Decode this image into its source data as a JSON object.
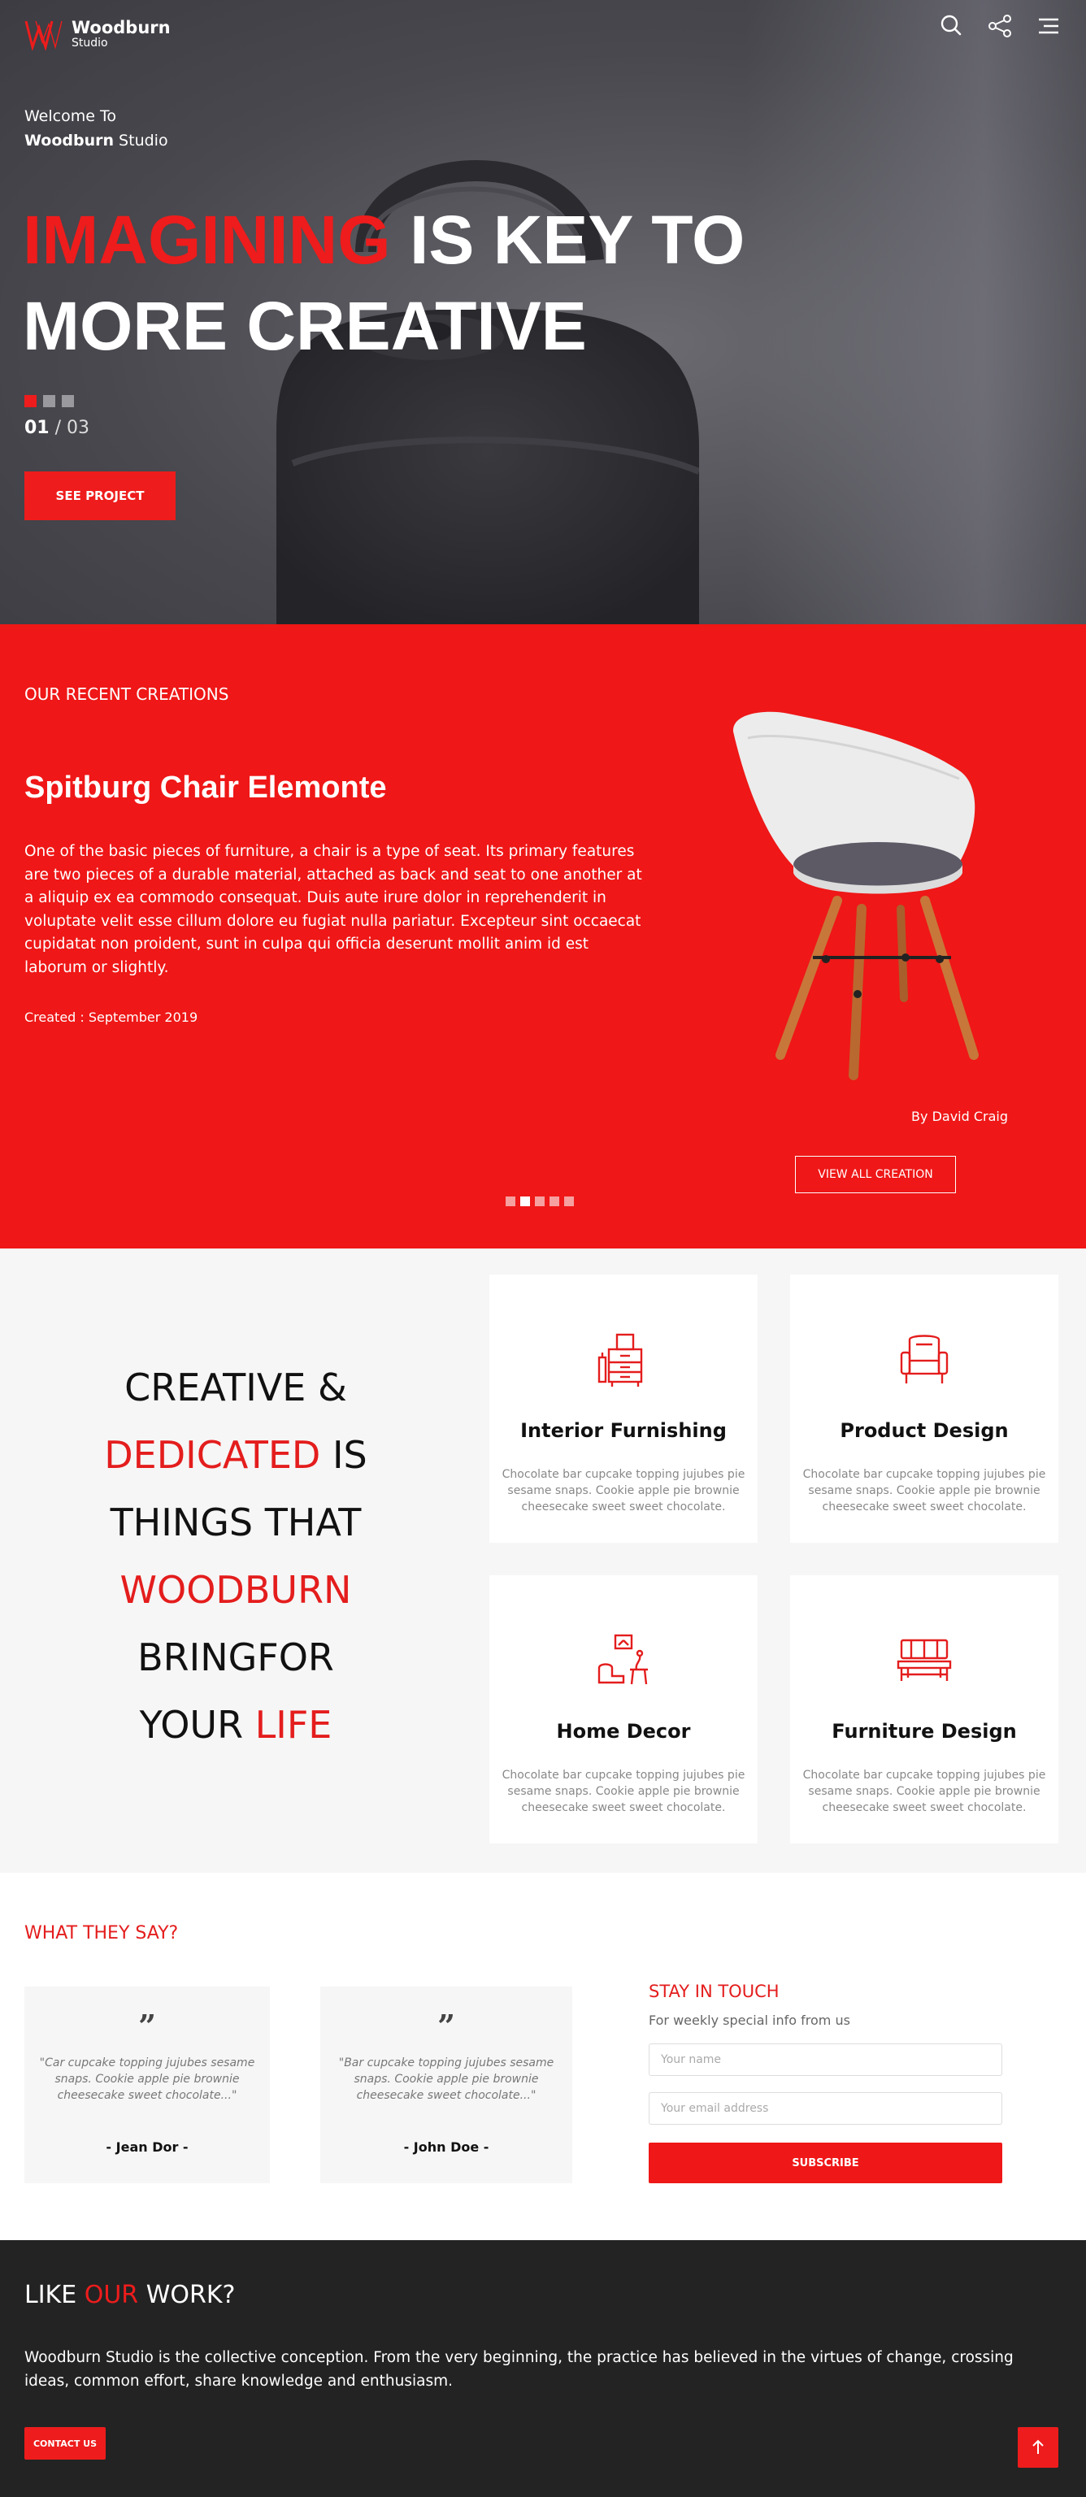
{
  "brand": {
    "name": "Woodburn",
    "sub": "Studio",
    "accent": "#ee1c1c"
  },
  "hero": {
    "welcome_line1": "Welcome To",
    "welcome_bold": "Woodburn",
    "welcome_rest": " Studio",
    "headline_red": "IMAGINING",
    "headline_rest": " IS KEY TO",
    "headline_line2": "MORE CREATIVE",
    "slide_current": "01",
    "slide_sep": " / ",
    "slide_total": "03",
    "cta": "SEE PROJECT",
    "icons": [
      "search-icon",
      "share-icon",
      "menu-icon"
    ]
  },
  "recent": {
    "kicker": "OUR RECENT CREATIONS",
    "title": "Spitburg Chair Elemonte",
    "desc": "One of the basic pieces of furniture, a chair is a type of seat. Its primary features are two pieces of a durable material, attached as back and seat to one another at a aliquip ex ea commodo consequat. Duis aute irure dolor in reprehenderit in voluptate velit esse cillum dolore eu fugiat nulla pariatur. Excepteur sint occaecat cupidatat non proident, sunt in culpa qui officia deserunt mollit anim id est laborum or slightly.",
    "created": "Created : September 2019",
    "author": "By David Craig",
    "view_all": "VIEW ALL CREATION",
    "active_dot": 1,
    "dot_count": 5
  },
  "services": {
    "tagline": [
      [
        {
          "t": "CREATIVE &",
          "red": false
        }
      ],
      [
        {
          "t": "DEDICATED",
          "red": true
        },
        {
          "t": " IS",
          "red": false
        }
      ],
      [
        {
          "t": "THINGS THAT",
          "red": false
        }
      ],
      [
        {
          "t": "WOODBURN",
          "red": true
        }
      ],
      [
        {
          "t": "BRINGFOR",
          "red": false
        }
      ],
      [
        {
          "t": "YOUR ",
          "red": false
        },
        {
          "t": "LIFE",
          "red": true
        }
      ]
    ],
    "cards": [
      {
        "title": "Interior Furnishing",
        "icon": "cabinet-icon",
        "text": "Chocolate bar cupcake topping jujubes pie sesame snaps. Cookie apple pie brownie cheesecake sweet sweet chocolate."
      },
      {
        "title": "Product Design",
        "icon": "armchair-icon",
        "text": "Chocolate bar cupcake topping jujubes pie sesame snaps. Cookie apple pie brownie cheesecake sweet sweet chocolate."
      },
      {
        "title": "Home Decor",
        "icon": "living-room-icon",
        "text": "Chocolate bar cupcake topping jujubes pie sesame snaps. Cookie apple pie brownie cheesecake sweet sweet chocolate."
      },
      {
        "title": "Furniture Design",
        "icon": "bench-icon",
        "text": "Chocolate bar cupcake topping jujubes pie sesame snaps. Cookie apple pie brownie cheesecake sweet sweet chocolate."
      }
    ]
  },
  "testimonials": {
    "title": "WHAT THEY SAY?",
    "items": [
      {
        "quote": "\"Car cupcake topping jujubes sesame snaps. Cookie apple pie brownie cheesecake sweet chocolate...\"",
        "name": "- Jean Dor -"
      },
      {
        "quote": "\"Bar cupcake topping jujubes sesame snaps. Cookie apple pie brownie cheesecake sweet chocolate...\"",
        "name": "- John Doe -"
      }
    ]
  },
  "newsletter": {
    "title": "STAY IN TOUCH",
    "sub": "For weekly special info from us",
    "name_placeholder": "Your name",
    "email_placeholder": "Your email address",
    "button": "SUBSCRIBE"
  },
  "footer": {
    "title_a": "LIKE ",
    "title_red": "OUR",
    "title_b": " WORK?",
    "desc": "Woodburn Studio is the collective conception. From the very beginning, the practice has believed in the virtues of change, crossing ideas, common effort, share knowledge and enthusiasm.",
    "contact": "CONTACT US"
  }
}
